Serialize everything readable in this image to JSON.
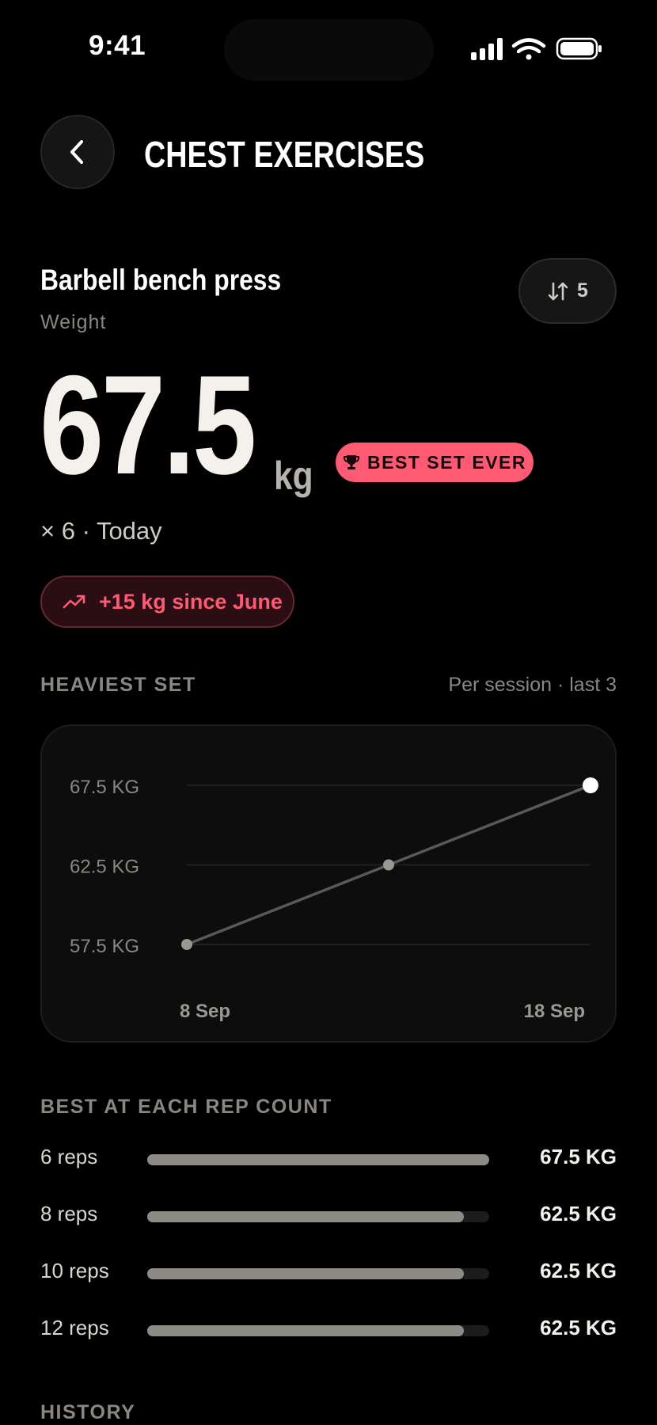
{
  "status_bar": {
    "time": "9:41"
  },
  "header": {
    "title": "CHEST EXERCISES"
  },
  "exercise": {
    "name": "Barbell bench press",
    "metric_label": "Weight",
    "sort_count": "5",
    "value": "67.5",
    "unit": "kg",
    "best_badge": "BEST SET EVER",
    "set_meta": "× 6 · Today",
    "progress": "+15 kg since June"
  },
  "heaviest": {
    "title": "HEAVIEST SET",
    "note": "Per session · last 3"
  },
  "chart_data": {
    "type": "line",
    "x_labels": [
      "8 Sep",
      "18 Sep"
    ],
    "y_ticks": [
      "67.5 KG",
      "62.5 KG",
      "57.5 KG"
    ],
    "y_tick_values": [
      67.5,
      62.5,
      57.5
    ],
    "ylim": [
      57.5,
      67.5
    ],
    "series": [
      {
        "values": [
          57.5,
          62.5,
          67.5
        ]
      }
    ],
    "grid": true
  },
  "rep_best": {
    "title": "BEST AT EACH REP COUNT",
    "rows": [
      {
        "label": "6 reps",
        "value": "67.5 KG",
        "fraction": 1.0
      },
      {
        "label": "8 reps",
        "value": "62.5 KG",
        "fraction": 0.926
      },
      {
        "label": "10 reps",
        "value": "62.5 KG",
        "fraction": 0.926
      },
      {
        "label": "12 reps",
        "value": "62.5 KG",
        "fraction": 0.926
      }
    ]
  },
  "history": {
    "title": "HISTORY"
  },
  "colors": {
    "accent": "#ff5a73",
    "background": "#000000",
    "text": "#f4f1ec",
    "muted": "#8a8782"
  }
}
